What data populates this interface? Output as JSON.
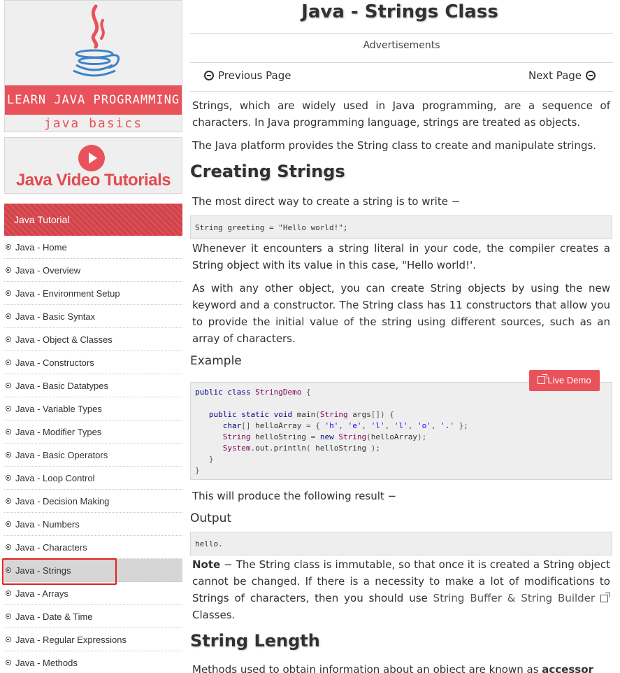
{
  "sidebar": {
    "logo_banner": {
      "title": "LEARN JAVA PROGRAMMING",
      "subtitle": "java basics"
    },
    "video_banner": {
      "label": "Java Video Tutorials"
    },
    "section_header": "Java Tutorial",
    "items": [
      "Java - Home",
      "Java - Overview",
      "Java - Environment Setup",
      "Java - Basic Syntax",
      "Java - Object & Classes",
      "Java - Constructors",
      "Java - Basic Datatypes",
      "Java - Variable Types",
      "Java - Modifier Types",
      "Java - Basic Operators",
      "Java - Loop Control",
      "Java - Decision Making",
      "Java - Numbers",
      "Java - Characters",
      "Java - Strings",
      "Java - Arrays",
      "Java - Date & Time",
      "Java - Regular Expressions",
      "Java - Methods"
    ],
    "active_item": "Java - Strings"
  },
  "main": {
    "title": "Java - Strings Class",
    "ads_label": "Advertisements",
    "prev_label": "Previous Page",
    "next_label": "Next Page",
    "intro_p1": "Strings, which are widely used in Java programming, are a sequence of characters. In Java programming language, strings are treated as objects.",
    "intro_p2": "The Java platform provides the String class to create and manipulate strings.",
    "h_creating": "Creating Strings",
    "creating_p1": "The most direct way to create a string is to write −",
    "code1": "String greeting = \"Hello world!\";",
    "creating_p2": "Whenever it encounters a string literal in your code, the compiler creates a String object with its value in this case, \"Hello world!'.",
    "creating_p3": "As with any other object, you can create String objects by using the new keyword and a constructor. The String class has 11 constructors that allow you to provide the initial value of the string using different sources, such as an array of characters.",
    "h_example": "Example",
    "live_demo_label": "Live Demo",
    "example_code": [
      "public class StringDemo {",
      "",
      "   public static void main(String args[]) {",
      "      char[] helloArray = { 'h', 'e', 'l', 'l', 'o', '.' };",
      "      String helloString = new String(helloArray);",
      "      System.out.println( helloString );",
      "   }",
      "}"
    ],
    "result_intro": "This will produce the following result −",
    "h_output": "Output",
    "output_code": "hello.",
    "note_label": "Note",
    "note_text_1": " − The String class is immutable, so that once it is created a String object cannot be changed. If there is a necessity to make a lot of modifications to Strings of characters, then you should use ",
    "note_link": "String Buffer & String Builder",
    "note_text_2": " Classes.",
    "h_length": "String Length",
    "length_p1_a": "Methods used to obtain information about an object are known as ",
    "length_p1_b": "accessor"
  }
}
